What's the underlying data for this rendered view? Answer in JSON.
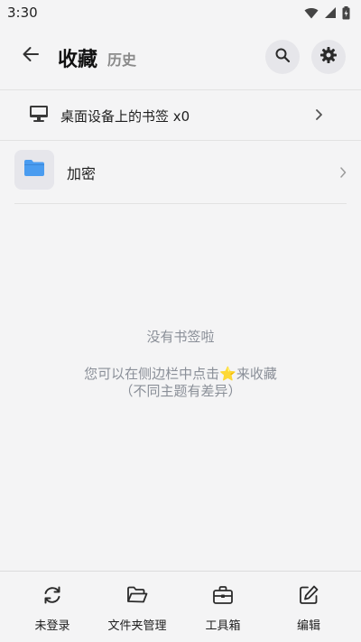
{
  "status_bar": {
    "time": "3:30",
    "icons": [
      "wifi-icon",
      "signal-icon",
      "battery-icon"
    ]
  },
  "header": {
    "back_icon": "arrow-left-icon",
    "title": "收藏",
    "history_tab": "历史",
    "search_icon": "search-icon",
    "settings_icon": "gear-icon"
  },
  "desktop_bookmarks": {
    "icon": "monitor-icon",
    "label": "桌面设备上的书签 x0"
  },
  "folders": [
    {
      "icon": "folder-icon",
      "label": "加密",
      "color": "#4a9cf0"
    }
  ],
  "empty_state": {
    "title": "没有书签啦",
    "hint_before": "您可以在侧边栏中点击",
    "hint_star": "⭐",
    "hint_after": "来收藏",
    "hint_sub": "（不同主题有差异）"
  },
  "bottom_nav": [
    {
      "icon": "sync-icon",
      "label": "未登录"
    },
    {
      "icon": "folder-open-icon",
      "label": "文件夹管理"
    },
    {
      "icon": "toolbox-icon",
      "label": "工具箱"
    },
    {
      "icon": "edit-icon",
      "label": "编辑"
    }
  ],
  "colors": {
    "background": "#f4f4f5",
    "folder_blue": "#4a9cf0",
    "button_bg": "#e6e6ea",
    "muted_text": "#8a8f98"
  }
}
